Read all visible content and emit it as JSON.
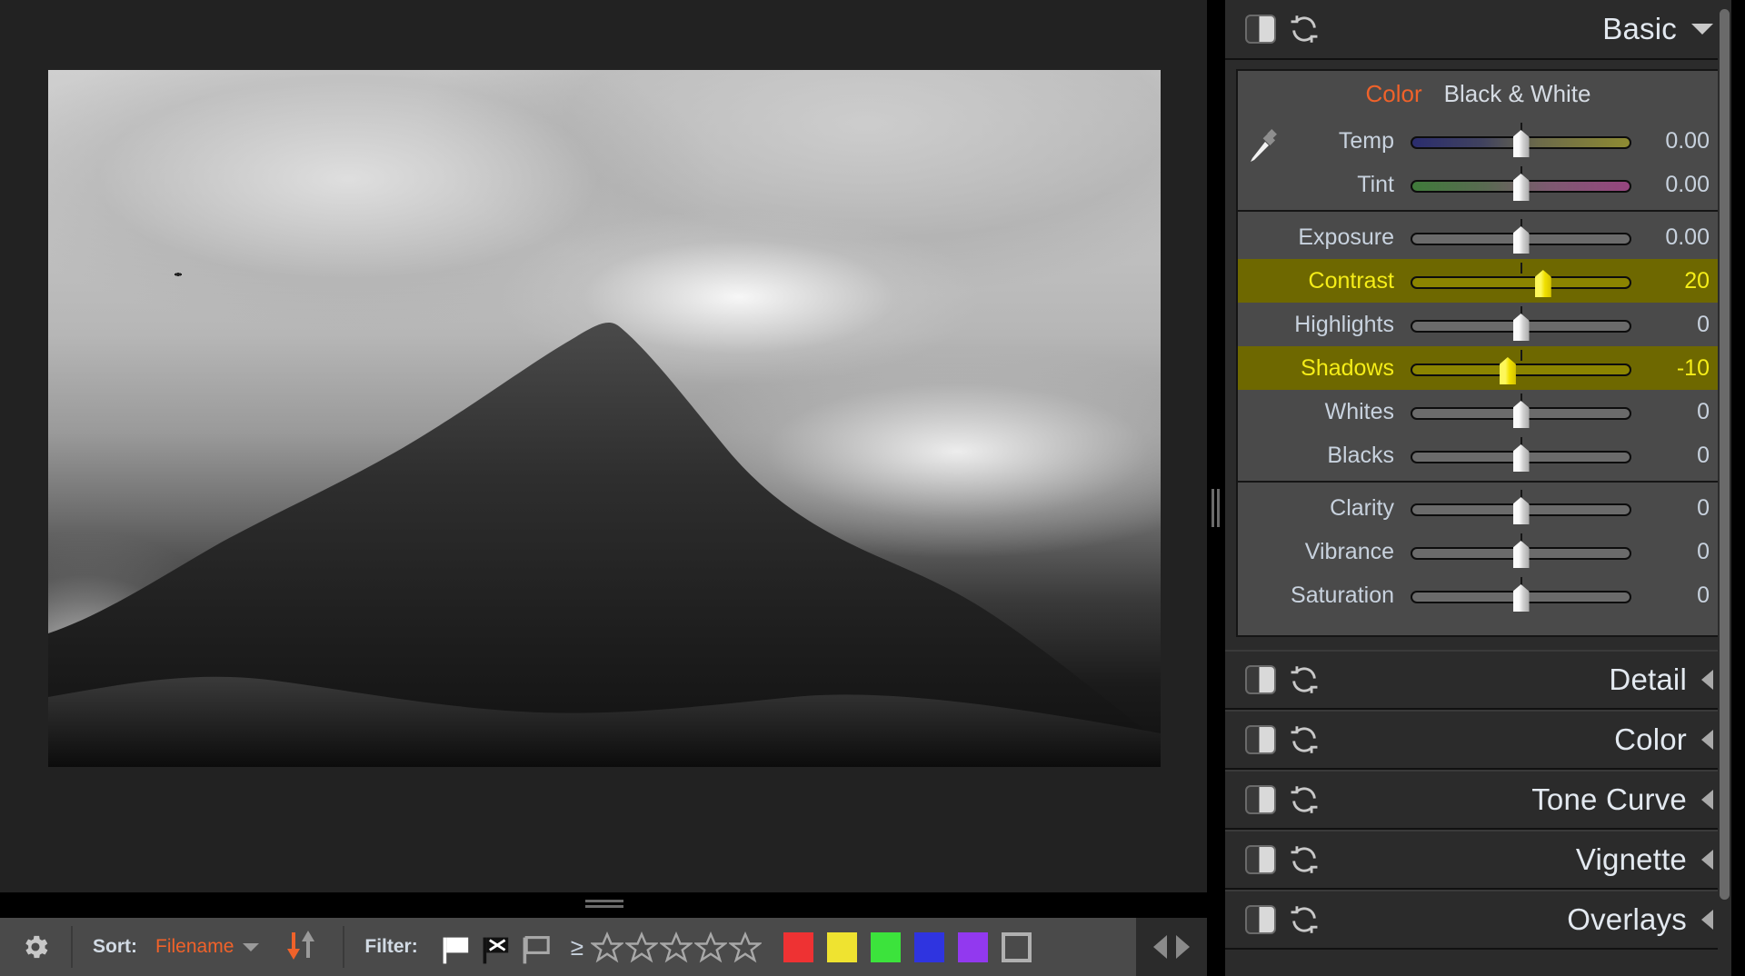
{
  "panels": {
    "basic": {
      "title": "Basic",
      "expanded": true,
      "toggle_icon": "panel-toggle-icon",
      "reset_icon": "reset-icon",
      "expand_icon": "chevron-down-icon",
      "tabs": [
        {
          "label": "Color",
          "active": true
        },
        {
          "label": "Black & White",
          "active": false
        }
      ],
      "eyedropper_icon": "eyedropper-icon",
      "groups": [
        {
          "name": "white-balance",
          "sliders": [
            {
              "label": "Temp",
              "value": "0.00",
              "pos": 50,
              "tick": 50,
              "gradient": "temp",
              "highlight": false
            },
            {
              "label": "Tint",
              "value": "0.00",
              "pos": 50,
              "tick": 50,
              "gradient": "tint",
              "highlight": false
            }
          ]
        },
        {
          "name": "tone",
          "sliders": [
            {
              "label": "Exposure",
              "value": "0.00",
              "pos": 50,
              "tick": 50,
              "gradient": "none",
              "highlight": false
            },
            {
              "label": "Contrast",
              "value": "20",
              "pos": 60,
              "tick": 50,
              "gradient": "none",
              "highlight": true
            },
            {
              "label": "Highlights",
              "value": "0",
              "pos": 50,
              "tick": 50,
              "gradient": "none",
              "highlight": false
            },
            {
              "label": "Shadows",
              "value": "-10",
              "pos": 44,
              "tick": 50,
              "gradient": "none",
              "highlight": true
            },
            {
              "label": "Whites",
              "value": "0",
              "pos": 50,
              "tick": 50,
              "gradient": "none",
              "highlight": false
            },
            {
              "label": "Blacks",
              "value": "0",
              "pos": 50,
              "tick": 50,
              "gradient": "none",
              "highlight": false
            }
          ]
        },
        {
          "name": "presence",
          "sliders": [
            {
              "label": "Clarity",
              "value": "0",
              "pos": 50,
              "tick": 50,
              "gradient": "none",
              "highlight": false
            },
            {
              "label": "Vibrance",
              "value": "0",
              "pos": 50,
              "tick": 50,
              "gradient": "none",
              "highlight": false
            },
            {
              "label": "Saturation",
              "value": "0",
              "pos": 50,
              "tick": 50,
              "gradient": "none",
              "highlight": false
            }
          ]
        }
      ]
    },
    "collapsed": [
      {
        "title": "Detail",
        "toggle_icon": "panel-toggle-icon",
        "reset_icon": "reset-icon",
        "expand_icon": "chevron-left-icon"
      },
      {
        "title": "Color",
        "toggle_icon": "panel-toggle-icon",
        "reset_icon": "reset-icon",
        "expand_icon": "chevron-left-icon"
      },
      {
        "title": "Tone Curve",
        "toggle_icon": "panel-toggle-icon",
        "reset_icon": "reset-icon",
        "expand_icon": "chevron-left-icon"
      },
      {
        "title": "Vignette",
        "toggle_icon": "panel-toggle-icon",
        "reset_icon": "reset-icon",
        "expand_icon": "chevron-left-icon"
      },
      {
        "title": "Overlays",
        "toggle_icon": "panel-toggle-icon",
        "reset_icon": "reset-icon",
        "expand_icon": "chevron-left-icon"
      }
    ]
  },
  "toolbar": {
    "settings_icon": "gear-icon",
    "sort_label": "Sort:",
    "sort_value": "Filename",
    "sort_dropdown_icon": "chevron-down-icon",
    "sort_direction_icon": "sort-descending-icon",
    "filter_label": "Filter:",
    "flags": [
      {
        "name": "flag-picked",
        "state": "white"
      },
      {
        "name": "flag-rejected",
        "state": "black-x"
      },
      {
        "name": "flag-unflagged",
        "state": "outline"
      }
    ],
    "rating_operator": "≥",
    "stars": 5,
    "stars_selected": 0,
    "color_labels": [
      {
        "name": "label-red",
        "color": "#ee3233"
      },
      {
        "name": "label-yellow",
        "color": "#efe330"
      },
      {
        "name": "label-green",
        "color": "#3ce33c"
      },
      {
        "name": "label-blue",
        "color": "#2f34e0"
      },
      {
        "name": "label-purple",
        "color": "#9239ef"
      },
      {
        "name": "label-none",
        "color": "transparent"
      }
    ],
    "nav_prev_icon": "triangle-left-icon",
    "nav_next_icon": "triangle-right-icon"
  },
  "image_view": {
    "alt": "black-and-white mountain photograph with clouds",
    "splitter_vertical_icon": "vertical-splitter-grip",
    "splitter_horizontal_icon": "horizontal-splitter-grip"
  },
  "colors": {
    "accent": "#f0622a",
    "highlight_bg": "#6e6800",
    "highlight_text": "#f5ed18",
    "panel_bg": "#2b2b2b",
    "section_bg": "#4a4a4a",
    "text": "#c8d2de"
  }
}
